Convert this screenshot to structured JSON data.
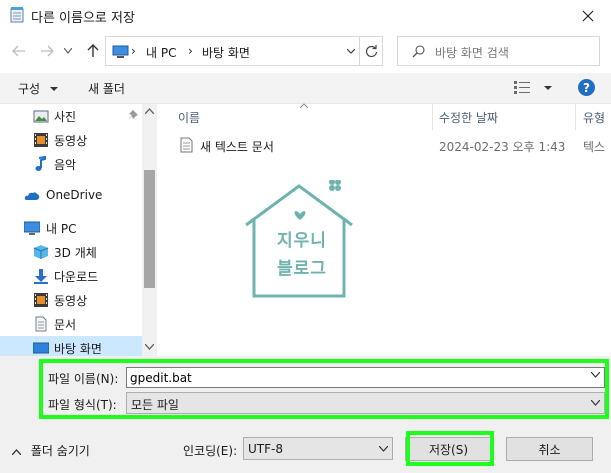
{
  "window": {
    "title": "다른 이름으로 저장"
  },
  "nav": {
    "breadcrumb": [
      "내 PC",
      "바탕 화면"
    ],
    "search_placeholder": "바탕 화면 검색"
  },
  "toolbar": {
    "organize": "구성",
    "new_folder": "새 폴더"
  },
  "sidebar": {
    "items": [
      {
        "label": "사진",
        "icon": "pictures-icon"
      },
      {
        "label": "동영상",
        "icon": "video-icon"
      },
      {
        "label": "음악",
        "icon": "music-icon"
      },
      {
        "label": "OneDrive",
        "icon": "onedrive-icon"
      },
      {
        "label": "내 PC",
        "icon": "pc-icon"
      },
      {
        "label": "3D 개체",
        "icon": "3d-objects-icon"
      },
      {
        "label": "다운로드",
        "icon": "download-icon"
      },
      {
        "label": "동영상",
        "icon": "video-icon"
      },
      {
        "label": "문서",
        "icon": "document-icon"
      },
      {
        "label": "바탕 화면",
        "icon": "desktop-icon"
      }
    ]
  },
  "file_list": {
    "columns": [
      "이름",
      "수정한 날짜",
      "유형"
    ],
    "rows": [
      {
        "name": "새 텍스트 문서",
        "modified": "2024-02-23 오후 1:43",
        "type": "텍스"
      }
    ]
  },
  "watermark": {
    "line1": "지우니",
    "line2": "블로그"
  },
  "form": {
    "filename_label": "파일 이름(N):",
    "filename_value": "gpedit.bat",
    "filetype_label": "파일 형식(T):",
    "filetype_value": "모든 파일",
    "hide_folders": "폴더 숨기기",
    "encoding_label": "인코딩(E):",
    "encoding_value": "UTF-8",
    "save_button": "저장(S)",
    "cancel_button": "취소"
  },
  "colors": {
    "highlight": "#1eff1e",
    "selection": "#cce8ff",
    "accent": "#1f6fc5",
    "watermark": "#6fb3b0"
  }
}
